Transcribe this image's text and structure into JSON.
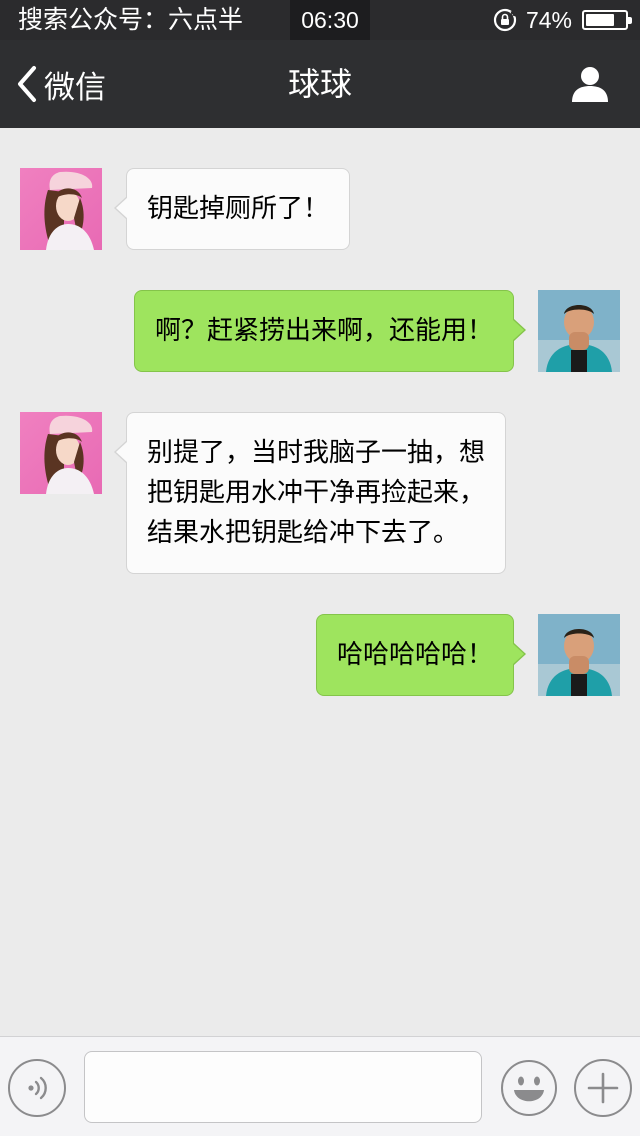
{
  "status_bar": {
    "carrier": "搜索公众号：六点半",
    "time": "06:30",
    "battery_text": "74%",
    "battery_level": 0.74
  },
  "nav": {
    "back_label": "微信",
    "title": "球球",
    "profile_icon": "person-icon"
  },
  "messages": [
    {
      "side": "received",
      "text": "钥匙掉厕所了！",
      "avatar": "female-avatar"
    },
    {
      "side": "sent",
      "text": "啊？赶紧捞出来啊，还能用！",
      "avatar": "male-avatar"
    },
    {
      "side": "received",
      "lines": [
        "别提了，当时我脑子一抽，想",
        "把钥匙用水冲干净再捡起来，",
        "结果水把钥匙给冲下去了。"
      ],
      "avatar": "female-avatar"
    },
    {
      "side": "sent",
      "text": "哈哈哈哈哈！",
      "avatar": "male-avatar"
    }
  ],
  "input_bar": {
    "voice_icon": "voice-icon",
    "input_value": "",
    "emoji_icon": "emoji-icon",
    "plus_icon": "plus-icon"
  },
  "colors": {
    "nav_bg": "#2e2f31",
    "chat_bg": "#ebebeb",
    "sent_bubble": "#9ee45e",
    "received_bubble": "#fbfbfb"
  }
}
